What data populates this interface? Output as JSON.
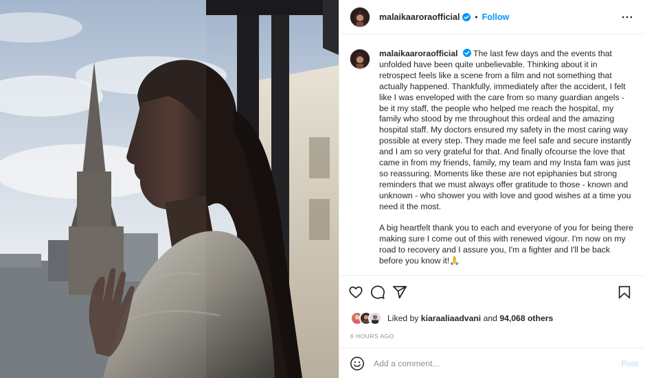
{
  "header": {
    "username": "malaikaaroraofficial",
    "separator": "•",
    "follow_label": "Follow",
    "more_icon": "more-options-icon"
  },
  "caption": {
    "username": "malaikaaroraofficial",
    "paragraphs": [
      "The last few days and the events that unfolded have been quite unbelievable. Thinking about it in retrospect feels like a scene from a film and not something that actually happened. Thankfully, immediately after the accident, I felt like I was enveloped with the care from so many guardian angels - be it my staff, the people who helped me reach the hospital, my family who stood by me throughout this ordeal and the amazing hospital staff. My doctors ensured my safety in the most caring way possible at every step. They made me feel safe and secure instantly and I am so very grateful for that. And finally ofcourse the love that came in from my friends, family, my team and my Insta fam was just so reassuring. Moments like these are not epiphanies but strong reminders that we must always offer gratitude to those - known and unknown - who shower you with love and good wishes at a time you need it the most.",
      "A big heartfelt thank you to each and everyone of you for being there making sure I come out of this with renewed vigour. I'm now on my road to recovery and I assure you, I'm a fighter and I'll be back before you know it!🙏"
    ]
  },
  "actions": {
    "icons": [
      "heart-icon",
      "comment-icon",
      "share-icon",
      "bookmark-icon"
    ]
  },
  "likes": {
    "prefix": "Liked by",
    "user": "kiaraaliaadvani",
    "joiner": "and",
    "count": "94,068 others"
  },
  "timestamp": "6 HOURS AGO",
  "comment": {
    "placeholder": "Add a comment...",
    "post_label": "Post"
  },
  "colors": {
    "accent": "#0095f6",
    "post_disabled": "#b2dffc",
    "muted": "#8e8e8e",
    "text": "#262626"
  }
}
